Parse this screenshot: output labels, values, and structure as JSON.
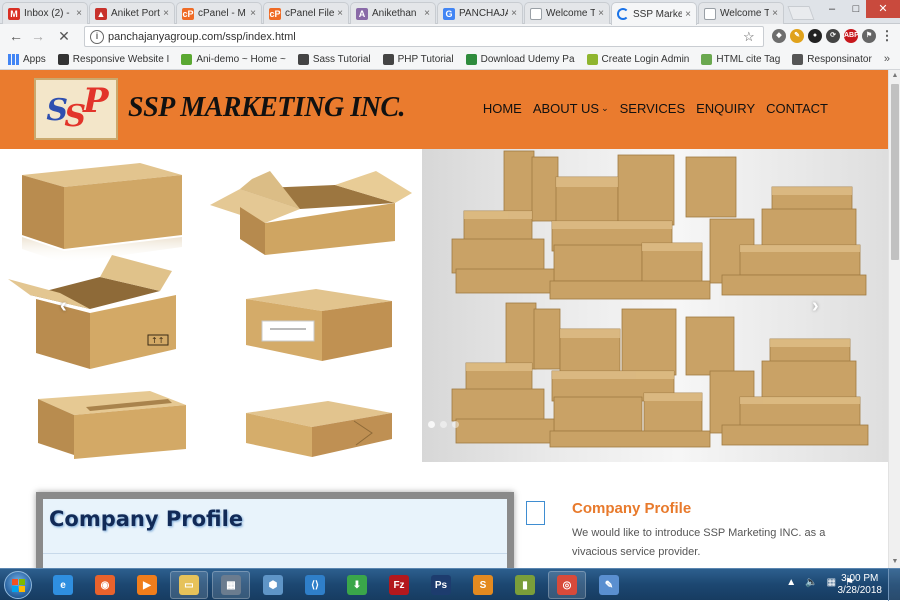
{
  "browser": {
    "tabs": [
      {
        "label": "Inbox (2) -",
        "icon": "gmail-icon",
        "color": "#d93025",
        "glyph": "M"
      },
      {
        "label": "Aniket Port",
        "icon": "portfolio-icon",
        "color": "#c8312b",
        "glyph": "▲"
      },
      {
        "label": "cPanel - M",
        "icon": "cpanel-icon",
        "color": "#ef6b26",
        "glyph": "cP"
      },
      {
        "label": "cPanel File",
        "icon": "cpanel-icon",
        "color": "#ef6b26",
        "glyph": "cP"
      },
      {
        "label": "Anikethan",
        "icon": "site-icon",
        "color": "#8a6aa8",
        "glyph": "A"
      },
      {
        "label": "PANCHAJA",
        "icon": "google-icon",
        "color": "#4285f4",
        "glyph": "G"
      },
      {
        "label": "Welcome T",
        "icon": "page-icon",
        "color": "#9aa0a6",
        "glyph": ""
      },
      {
        "label": "SSP Marke",
        "icon": "loading-icon",
        "color": "#1a73e8",
        "glyph": ""
      },
      {
        "label": "Welcome T",
        "icon": "page-icon",
        "color": "#9aa0a6",
        "glyph": ""
      }
    ],
    "tab_close": "×",
    "window_controls": {
      "minimize": "–",
      "maximize": "□",
      "close": "✕"
    },
    "url": "panchajanyagroup.com/ssp/index.html",
    "extensions": [
      {
        "name": "extension-icon-1",
        "color": "#6d6d6d",
        "glyph": "◆"
      },
      {
        "name": "extension-icon-2",
        "color": "#e0a21b",
        "glyph": "✎"
      },
      {
        "name": "extension-icon-3",
        "color": "#222222",
        "glyph": "●"
      },
      {
        "name": "extension-icon-4",
        "color": "#444444",
        "glyph": "⟳"
      },
      {
        "name": "adblock-plus-icon",
        "color": "#c7181d",
        "glyph": "ABP"
      },
      {
        "name": "extension-icon-6",
        "color": "#666666",
        "glyph": "⚑"
      },
      {
        "name": "chrome-menu-icon",
        "color": "#555555",
        "glyph": "⋮"
      }
    ]
  },
  "bookmarks": {
    "items": [
      {
        "label": "Apps",
        "color": "#4285f4"
      },
      {
        "label": "Responsive Website I",
        "color": "#333333"
      },
      {
        "label": "Ani-demo ~ Home ~",
        "color": "#5aa832"
      },
      {
        "label": "Sass Tutorial",
        "color": "#444444"
      },
      {
        "label": "PHP Tutorial",
        "color": "#444444"
      },
      {
        "label": "Download Udemy Pa",
        "color": "#2e8b3c"
      },
      {
        "label": "Create Login Admin",
        "color": "#8fb52f"
      },
      {
        "label": "HTML cite Tag",
        "color": "#6aa84f"
      },
      {
        "label": "Responsinator",
        "color": "#555555"
      }
    ],
    "more": "»"
  },
  "site": {
    "logo": {
      "s1": "S",
      "s2": "S",
      "p": "P"
    },
    "brand": "SSP MARKETING INC.",
    "nav": [
      {
        "label": "HOME",
        "caret": ""
      },
      {
        "label": "ABOUT US",
        "caret": "⌄"
      },
      {
        "label": "SERVICES",
        "caret": ""
      },
      {
        "label": "ENQUIRY",
        "caret": ""
      },
      {
        "label": "CONTACT",
        "caret": ""
      }
    ],
    "slider": {
      "prev": "‹",
      "next": "›",
      "slide_count": 3,
      "active_slide": 1
    },
    "company_profile": {
      "box_title": "Company Profile",
      "heading": "Company Profile",
      "text": "We would like to introduce SSP Marketing INC. as a vivacious service provider."
    },
    "colors": {
      "header_orange": "#ea7b2e",
      "heading_orange": "#e87a2c",
      "cardboard": "#c9a266"
    }
  },
  "taskbar": {
    "apps": [
      {
        "name": "ie-icon",
        "color": "#2f8fe0",
        "glyph": "e"
      },
      {
        "name": "firefox-icon",
        "color": "#e8622c",
        "glyph": "◉"
      },
      {
        "name": "media-player-icon",
        "color": "#f07d1b",
        "glyph": "▶"
      },
      {
        "name": "file-explorer-icon",
        "color": "#e6c25a",
        "glyph": "▭"
      },
      {
        "name": "network-app-icon",
        "color": "#6b7c8f",
        "glyph": "▦"
      },
      {
        "name": "virtualbox-icon",
        "color": "#5f95c7",
        "glyph": "⬢"
      },
      {
        "name": "vscode-icon",
        "color": "#2f7fc9",
        "glyph": "⟨⟩"
      },
      {
        "name": "download-manager-icon",
        "color": "#3aa64a",
        "glyph": "⬇"
      },
      {
        "name": "filezilla-icon",
        "color": "#b3181d",
        "glyph": "Fz"
      },
      {
        "name": "photoshop-icon",
        "color": "#1d3c6e",
        "glyph": "Ps"
      },
      {
        "name": "sublime-icon",
        "color": "#e38a20",
        "glyph": "S"
      },
      {
        "name": "charts-app-icon",
        "color": "#7a9e3a",
        "glyph": "▮"
      },
      {
        "name": "chrome-icon",
        "color": "#d84a3a",
        "glyph": "◎"
      },
      {
        "name": "paint-icon",
        "color": "#5a8fd0",
        "glyph": "✎"
      }
    ],
    "tray": {
      "expand": "▲",
      "volume": "🔈",
      "network": "▦",
      "flag": "⚑"
    },
    "time": "3:00 PM",
    "date": "3/28/2018"
  }
}
